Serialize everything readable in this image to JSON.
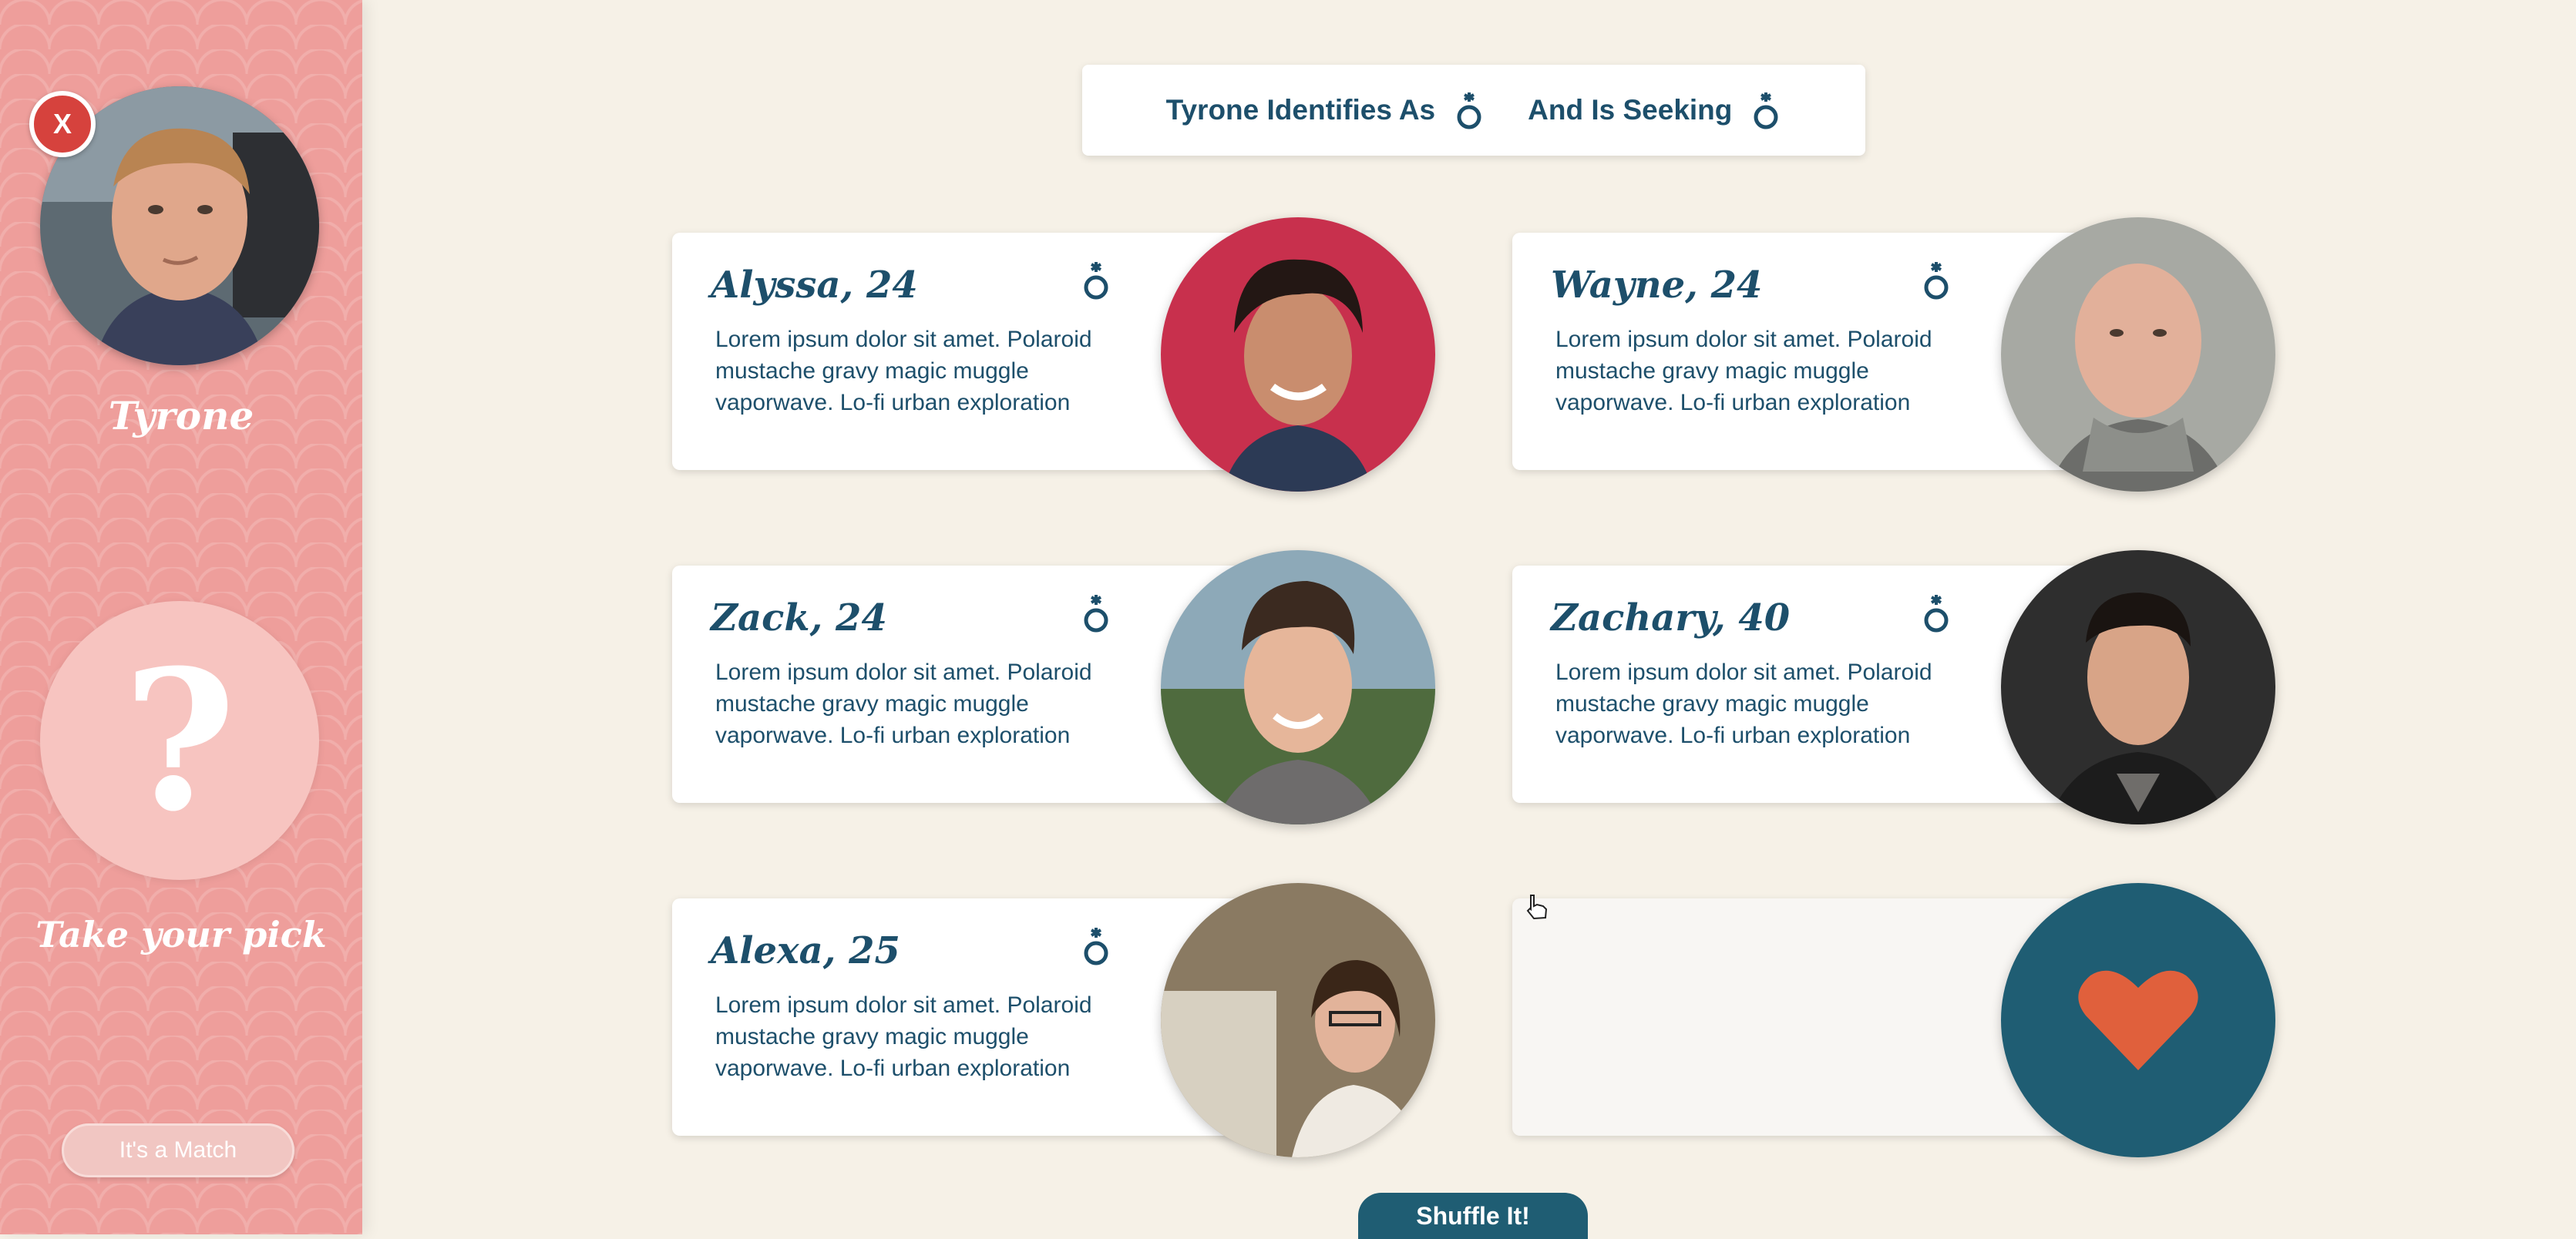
{
  "sidebar": {
    "close_label": "X",
    "user_name": "Tyrone",
    "mystery_symbol": "?",
    "pick_label": "Take your pick",
    "match_button": "It's a Match"
  },
  "header": {
    "identifies_label": "Tyrone Identifies As",
    "seeking_label": "And Is Seeking",
    "identifies_icon": "gender-icon",
    "seeking_icon": "gender-icon"
  },
  "cards": [
    {
      "name": "Alyssa, 24",
      "bio": "Lorem ipsum dolor sit amet. Polaroid mustache gravy magic muggle vaporwave. Lo-fi urban exploration",
      "photo_bg": "#c8304d"
    },
    {
      "name": "Wayne, 24",
      "bio": "Lorem ipsum dolor sit amet. Polaroid mustache gravy magic muggle vaporwave. Lo-fi urban exploration",
      "photo_bg": "#a7a9a3"
    },
    {
      "name": "Zack, 24",
      "bio": "Lorem ipsum dolor sit amet. Polaroid mustache gravy magic muggle vaporwave. Lo-fi urban exploration",
      "photo_bg": "#8da9b8"
    },
    {
      "name": "Zachary, 40",
      "bio": "Lorem ipsum dolor sit amet. Polaroid mustache gravy magic muggle vaporwave. Lo-fi urban exploration",
      "photo_bg": "#2e2e2e"
    },
    {
      "name": "Alexa, 25",
      "bio": "Lorem ipsum dolor sit amet. Polaroid mustache gravy magic muggle vaporwave. Lo-fi urban exploration",
      "photo_bg": "#8a7a62"
    }
  ],
  "heart_icon": "heart-icon",
  "shuffle_button": "Shuffle It!",
  "colors": {
    "sidebar": "#ee9e9b",
    "accent": "#1d4f6b",
    "heart": "#e0603c",
    "close": "#d6423d"
  }
}
